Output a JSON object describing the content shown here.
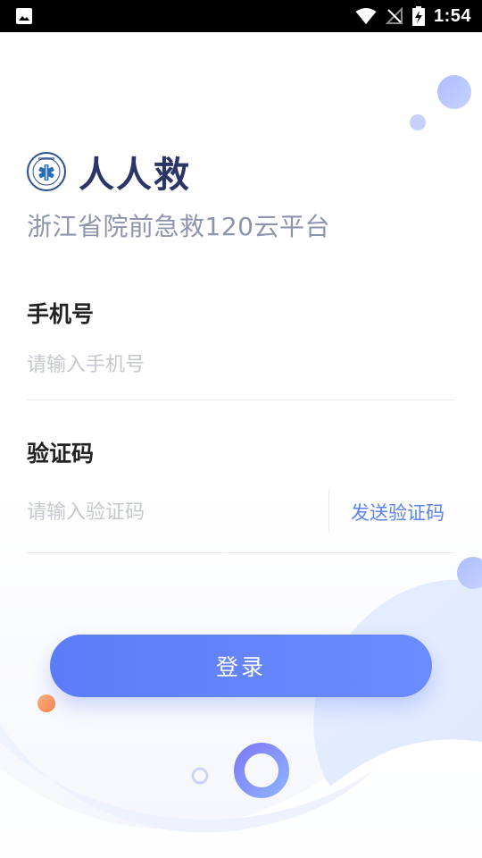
{
  "status_bar": {
    "time": "1:54"
  },
  "header": {
    "app_name": "人人救",
    "subtitle": "浙江省院前急救120云平台"
  },
  "form": {
    "phone": {
      "label": "手机号",
      "placeholder": "请输入手机号",
      "value": ""
    },
    "code": {
      "label": "验证码",
      "placeholder": "请输入验证码",
      "value": "",
      "send_label": "发送验证码"
    },
    "login_label": "登录"
  },
  "colors": {
    "accent": "#5c7cf7",
    "title": "#2b3566",
    "subtitle": "#8d94ad",
    "send_code": "#5b82f0"
  }
}
